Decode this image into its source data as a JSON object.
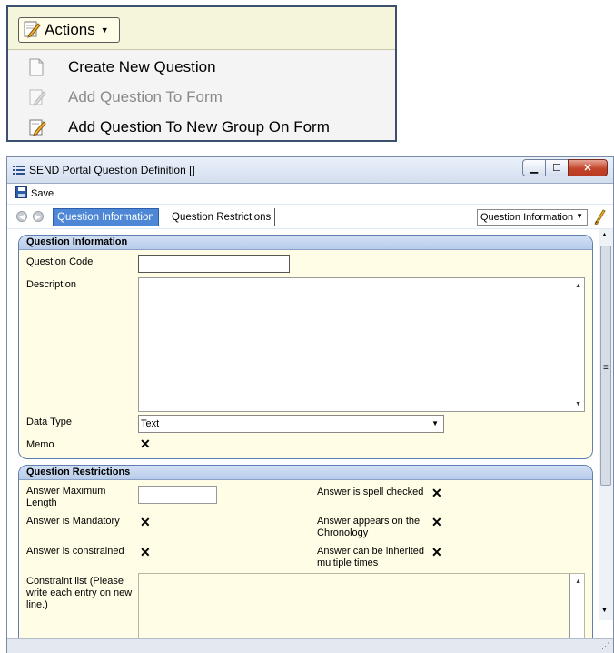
{
  "actions_menu": {
    "button_label": "Actions",
    "items": [
      {
        "label": "Create New Question",
        "icon": "blank-page-icon",
        "enabled": true
      },
      {
        "label": "Add Question To  Form",
        "icon": "form-pencil-icon",
        "enabled": false
      },
      {
        "label": "Add Question To New Group On Form",
        "icon": "form-pencil-icon",
        "enabled": true
      }
    ]
  },
  "window": {
    "title": "SEND Portal Question Definition []",
    "toolbar": {
      "save_label": "Save"
    },
    "tabs": [
      {
        "label": "Question Information",
        "active": true
      },
      {
        "label": "Question Restrictions",
        "active": false
      }
    ],
    "tab_select_value": "Question Information",
    "question_information": {
      "header": "Question Information",
      "code_label": "Question Code",
      "code_value": "",
      "description_label": "Description",
      "description_value": "",
      "data_type_label": "Data Type",
      "data_type_value": "Text",
      "memo_label": "Memo",
      "memo_checked": true
    },
    "question_restrictions": {
      "header": "Question Restrictions",
      "max_length_label": "Answer Maximum Length",
      "max_length_value": "",
      "mandatory_label": "Answer is Mandatory",
      "mandatory_checked": true,
      "constrained_label": "Answer is constrained",
      "constrained_checked": true,
      "spell_checked_label": "Answer is spell checked",
      "spell_checked_checked": true,
      "chronology_label": "Answer appears on the Chronology",
      "chronology_checked": true,
      "inherited_label": "Answer can be inherited multiple times",
      "inherited_checked": true,
      "constraint_list_label": "Constraint list (Please write each entry on new line.)",
      "constraint_list_value": ""
    },
    "check_glyph": "✕"
  }
}
